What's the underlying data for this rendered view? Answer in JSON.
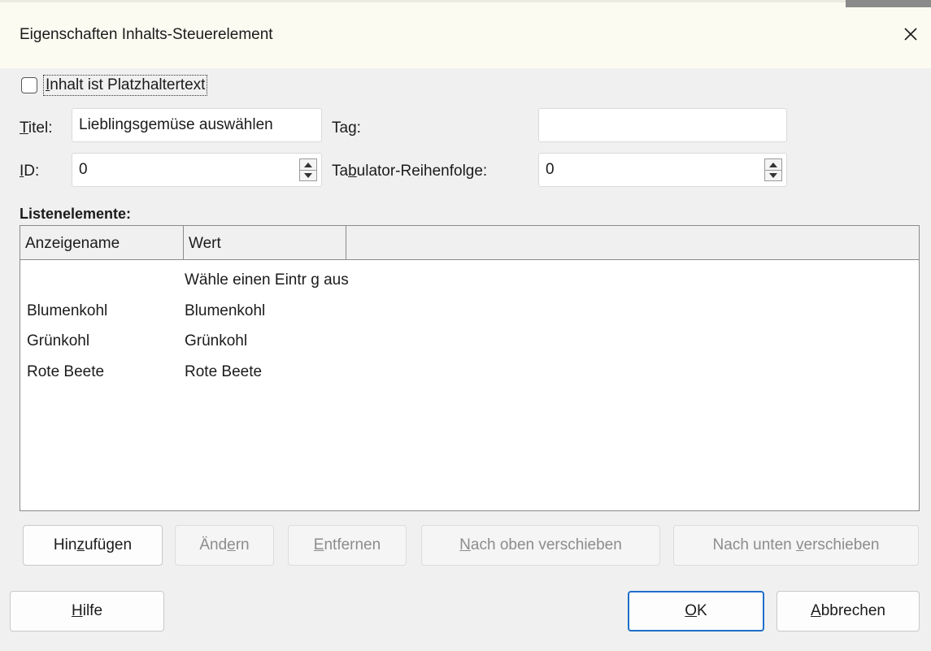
{
  "dialog": {
    "title": "Eigenschaften Inhalts-Steuerelement",
    "close_icon": "close-icon"
  },
  "placeholder_checkbox": {
    "checked": false,
    "label_mnemonic": "I",
    "label_rest": "nhalt ist Platzhaltertext"
  },
  "fields": {
    "title_label_mnemonic": "T",
    "title_label_rest": "itel:",
    "title_value": "Lieblingsgemüse auswählen",
    "tag_label": "Tag:",
    "tag_value": "",
    "id_label_mnemonic": "I",
    "id_label_rest": "D:",
    "id_value": "0",
    "tab_label_pre": "Ta",
    "tab_label_mnemonic": "b",
    "tab_label_post": "ulator-Reihenfolge:",
    "tab_value": "0"
  },
  "list": {
    "section_title": "Listenelemente:",
    "columns": [
      "Anzeigename",
      "Wert"
    ],
    "rows": [
      {
        "display": "",
        "value": "Wähle einen Eintr g aus"
      },
      {
        "display": "Blumenkohl",
        "value": "Blumenkohl"
      },
      {
        "display": "Grünkohl",
        "value": "Grünkohl"
      },
      {
        "display": "Rote Beete",
        "value": "Rote  Beete"
      }
    ]
  },
  "list_buttons": {
    "add": {
      "pre": "Hin",
      "mnemonic": "z",
      "post": "ufügen"
    },
    "change": {
      "pre": "Änd",
      "mnemonic": "e",
      "post": "rn"
    },
    "remove": {
      "pre": "",
      "mnemonic": "E",
      "post": "ntfernen"
    },
    "move_up": {
      "pre": "",
      "mnemonic": "N",
      "post": "ach oben verschieben"
    },
    "move_down": {
      "pre": "Nach unten ",
      "mnemonic": "v",
      "post": "erschieben"
    }
  },
  "footer_buttons": {
    "help": {
      "mnemonic": "H",
      "post": "ilfe"
    },
    "ok": {
      "mnemonic": "O",
      "post": "K"
    },
    "cancel": {
      "mnemonic": "A",
      "post": "bbrechen"
    }
  },
  "colors": {
    "accent": "#1e6fc8",
    "titlebar": "#fbfbf1",
    "dialog_bg": "#f0f0f0"
  }
}
